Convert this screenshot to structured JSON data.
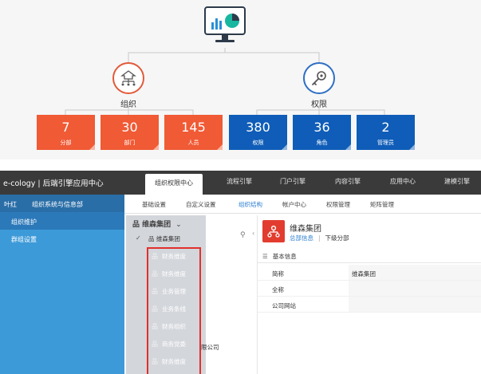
{
  "diagram": {
    "org_label": "组织",
    "perm_label": "权限",
    "stats": [
      {
        "value": "7",
        "caption": "分部",
        "color": "#f05a35"
      },
      {
        "value": "30",
        "caption": "部门",
        "color": "#f05a35"
      },
      {
        "value": "145",
        "caption": "人员",
        "color": "#f05a35"
      },
      {
        "value": "380",
        "caption": "权限",
        "color": "#0f5db8"
      },
      {
        "value": "36",
        "caption": "角色",
        "color": "#0f5db8"
      },
      {
        "value": "2",
        "caption": "管理员",
        "color": "#0f5db8"
      }
    ],
    "icons": {
      "monitor": "monitor-chart-icon",
      "org": "org-tree-icon",
      "perm": "key-icon"
    }
  },
  "app": {
    "brand": "e-cology | 后端引擎应用中心",
    "top_tabs": [
      "组织权限中心",
      "流程引擎",
      "门户引擎",
      "内容引擎",
      "应用中心",
      "建模引擎"
    ],
    "left_head": {
      "user": "叶红",
      "module": "组织系统与信息部"
    },
    "left_items": [
      "组织维护",
      "群组设置"
    ],
    "sub_tabs": [
      "基础设置",
      "自定义设置",
      "组织结构",
      "帐户中心",
      "权限管理",
      "矩阵管理"
    ],
    "tree": {
      "root": "维森集团",
      "root_chevron": "⌄",
      "selected": "维森集团",
      "items": [
        "财务维度",
        "财务维度",
        "业务管理",
        "业务条线",
        "财务组织",
        "商务党委",
        "财务维度"
      ],
      "overflow_text": "限公司"
    },
    "detail": {
      "title": "维森集团",
      "link_a": "总部信息",
      "link_sep": "|",
      "link_b": "下级分部",
      "section": "基本信息",
      "rows": [
        {
          "key": "简称",
          "value": "维森集团"
        },
        {
          "key": "全称",
          "value": ""
        },
        {
          "key": "公司网站",
          "value": ""
        }
      ]
    },
    "colors": {
      "accent_blue": "#3d9ad8",
      "header_dark": "#3a3a3a",
      "highlight_red": "#e0302c"
    }
  }
}
